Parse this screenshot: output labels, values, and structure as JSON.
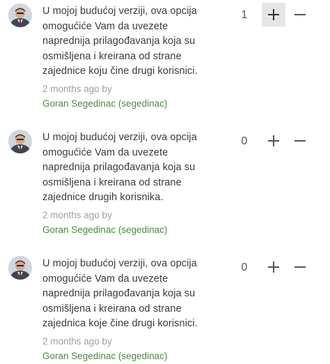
{
  "suggestions": [
    {
      "text": "U mojoj budućoj verziji, ova opcija omogućiće Vam da uvezete naprednija prilagođavanja koja su osmišljena i kreirana od strane zajednice koju čine drugi korisnici.",
      "time": "2 months ago by",
      "author": "Goran Segedinac (segedinac)",
      "votes": "1",
      "upvoted": true
    },
    {
      "text": "U mojoj budućoj verziji, ova opcija omogućiće Vam da uvezete naprednija prilagođavanja koja su osmišljena i kreirana od strane zajednice drugih korisnika.",
      "time": "2 months ago by",
      "author": "Goran Segedinac (segedinac)",
      "votes": "0",
      "upvoted": false
    },
    {
      "text": "U mojoj budućoj verziji, ova opcija omogućiće Vam da uvezete naprednija prilagođavanja koja su osmišljena i kreirana od strane zajednica koje čine drugi korisnici.",
      "time": "2 months ago by",
      "author": "Goran Segedinac (segedinac)",
      "votes": "0",
      "upvoted": false
    }
  ],
  "icons": {
    "upvote": "plus-icon",
    "downvote": "minus-icon",
    "avatar": "user-avatar"
  }
}
